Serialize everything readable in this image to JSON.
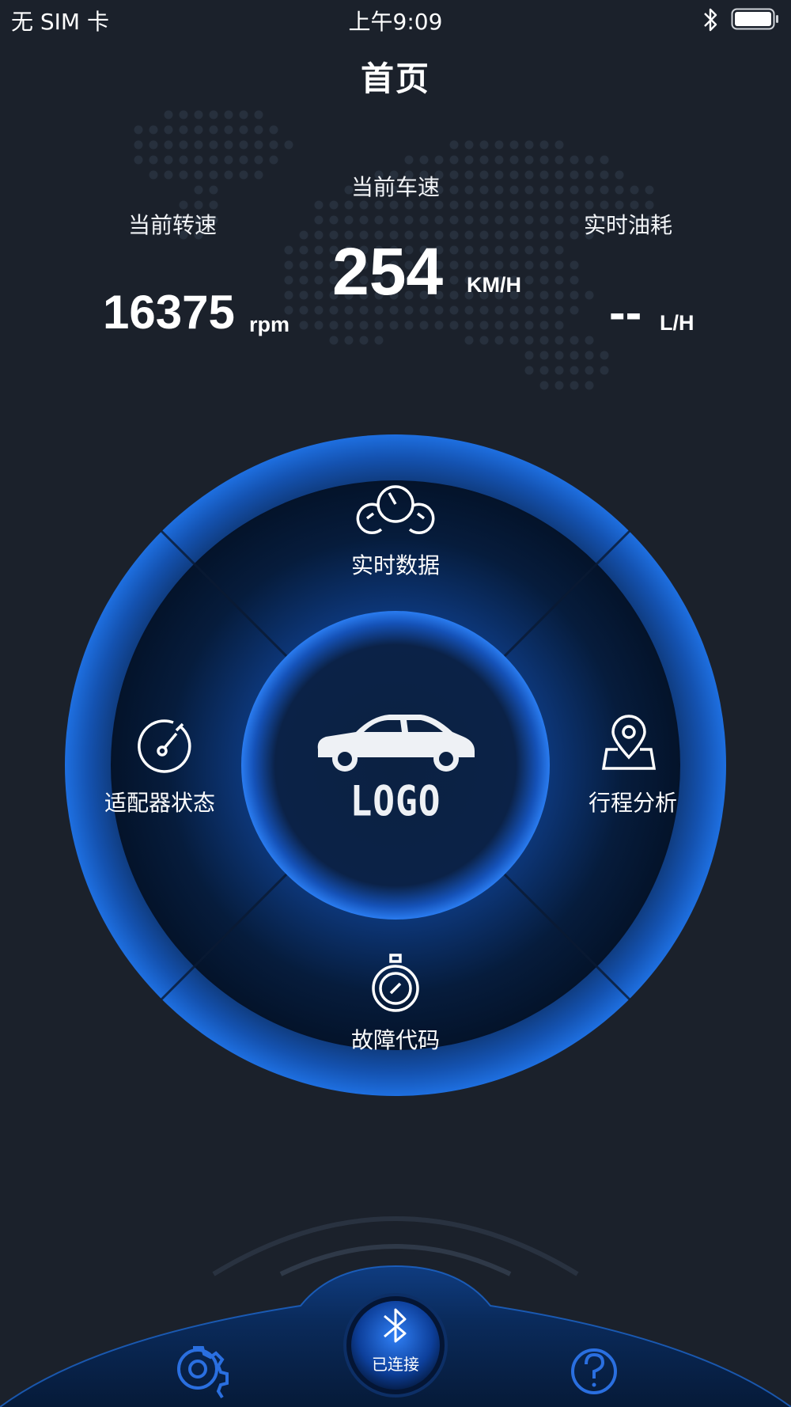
{
  "status_bar": {
    "carrier": "无 SIM 卡",
    "time": "上午9:09"
  },
  "header": {
    "title": "首页"
  },
  "stats": {
    "rpm": {
      "label": "当前转速",
      "value": "16375",
      "unit": "rpm"
    },
    "speed": {
      "label": "当前车速",
      "value": "254",
      "unit": "KM/H"
    },
    "fuel": {
      "label": "实时油耗",
      "value": "--",
      "unit": "L/H"
    }
  },
  "menu": {
    "realtime": {
      "label": "实时数据",
      "icon": "gauges-icon"
    },
    "adapter": {
      "label": "适配器状态",
      "icon": "speedometer-icon"
    },
    "trip": {
      "label": "行程分析",
      "icon": "map-pin-icon"
    },
    "fault": {
      "label": "故障代码",
      "icon": "stopwatch-icon"
    },
    "center": {
      "logo_text": "LOGO",
      "icon": "car-icon"
    }
  },
  "dock": {
    "connect_label": "已连接",
    "settings_icon": "gear-icon",
    "help_icon": "question-icon",
    "bluetooth_icon": "bluetooth-icon"
  },
  "colors": {
    "background": "#1b212b",
    "accent": "#1e6fe0",
    "ring_glow": "#2a7cf0"
  }
}
